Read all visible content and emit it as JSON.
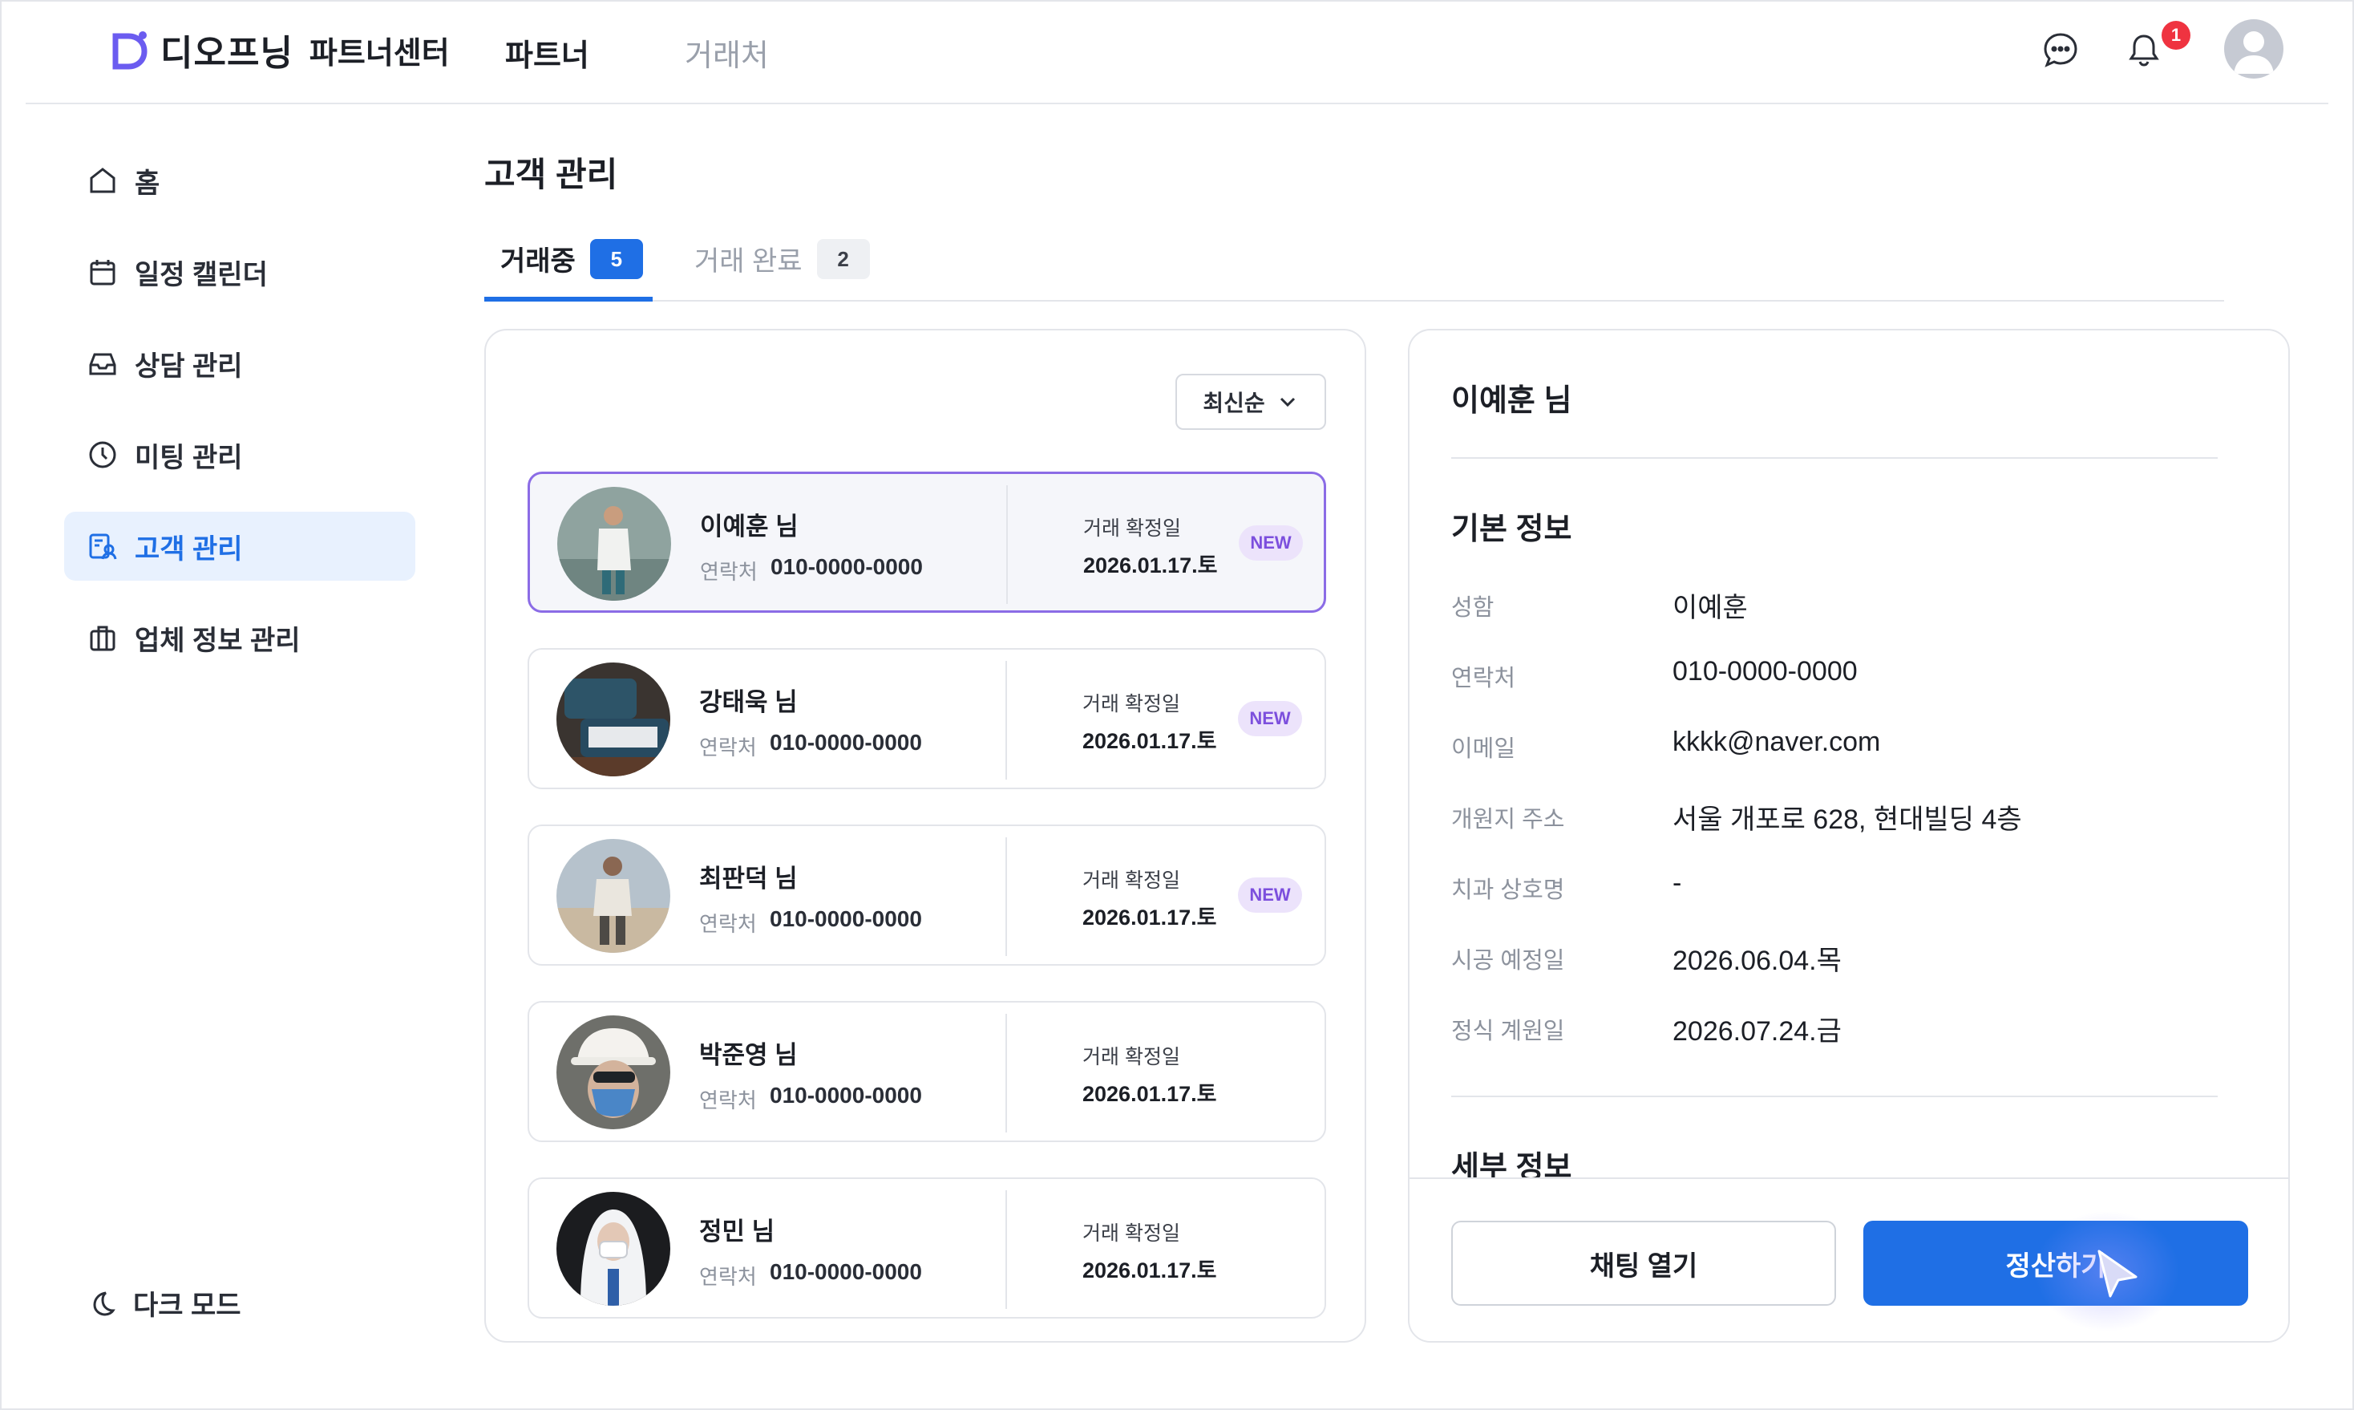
{
  "brand": {
    "name": "디오프닝",
    "sub": "파트너센터",
    "accent": "#1f6fe5",
    "logo_color": "#6b5cf0"
  },
  "nav": {
    "partner": "파트너",
    "client": "거래처"
  },
  "header": {
    "notification_count": "1",
    "icons": [
      "chat-icon",
      "bell-icon",
      "avatar"
    ]
  },
  "sidebar": {
    "items": [
      {
        "label": "홈",
        "icon": "home-icon"
      },
      {
        "label": "일정 캘린더",
        "icon": "calendar-icon"
      },
      {
        "label": "상담 관리",
        "icon": "inbox-icon"
      },
      {
        "label": "미팅 관리",
        "icon": "clock-icon"
      },
      {
        "label": "고객 관리",
        "icon": "customer-icon",
        "active": true
      },
      {
        "label": "업체 정보 관리",
        "icon": "briefcase-icon"
      }
    ],
    "dark_mode": "다크 모드"
  },
  "main": {
    "title": "고객 관리",
    "tabs": [
      {
        "label": "거래중",
        "count": "5"
      },
      {
        "label": "거래 완료",
        "count": "2"
      }
    ],
    "sort": "최신순"
  },
  "customers": [
    {
      "name": "이예훈 님",
      "contact_label": "연락처",
      "contact": "010-0000-0000",
      "date_label": "거래 확정일",
      "date": "2026.01.17.토",
      "badge": "NEW"
    },
    {
      "name": "강태욱 님",
      "contact_label": "연락처",
      "contact": "010-0000-0000",
      "date_label": "거래 확정일",
      "date": "2026.01.17.토",
      "badge": "NEW"
    },
    {
      "name": "최판덕 님",
      "contact_label": "연락처",
      "contact": "010-0000-0000",
      "date_label": "거래 확정일",
      "date": "2026.01.17.토",
      "badge": "NEW"
    },
    {
      "name": "박준영 님",
      "contact_label": "연락처",
      "contact": "010-0000-0000",
      "date_label": "거래 확정일",
      "date": "2026.01.17.토"
    },
    {
      "name": "정민 님",
      "contact_label": "연락처",
      "contact": "010-0000-0000",
      "date_label": "거래 확정일",
      "date": "2026.01.17.토"
    }
  ],
  "detail": {
    "name": "이예훈 님",
    "basic_title": "기본 정보",
    "rows": [
      {
        "label": "성함",
        "value": "이예훈"
      },
      {
        "label": "연락처",
        "value": "010-0000-0000"
      },
      {
        "label": "이메일",
        "value": "kkkk@naver.com"
      },
      {
        "label": "개원지 주소",
        "value": "서울 개포로 628, 현대빌딩 4층"
      },
      {
        "label": "치과 상호명",
        "value": "-"
      },
      {
        "label": "시공 예정일",
        "value": "2026.06.04.목"
      },
      {
        "label": "정식 계원일",
        "value": "2026.07.24.금"
      }
    ],
    "detail_title": "세부 정보",
    "chat_button": "채팅 열기",
    "settle_button": "정산하기"
  }
}
